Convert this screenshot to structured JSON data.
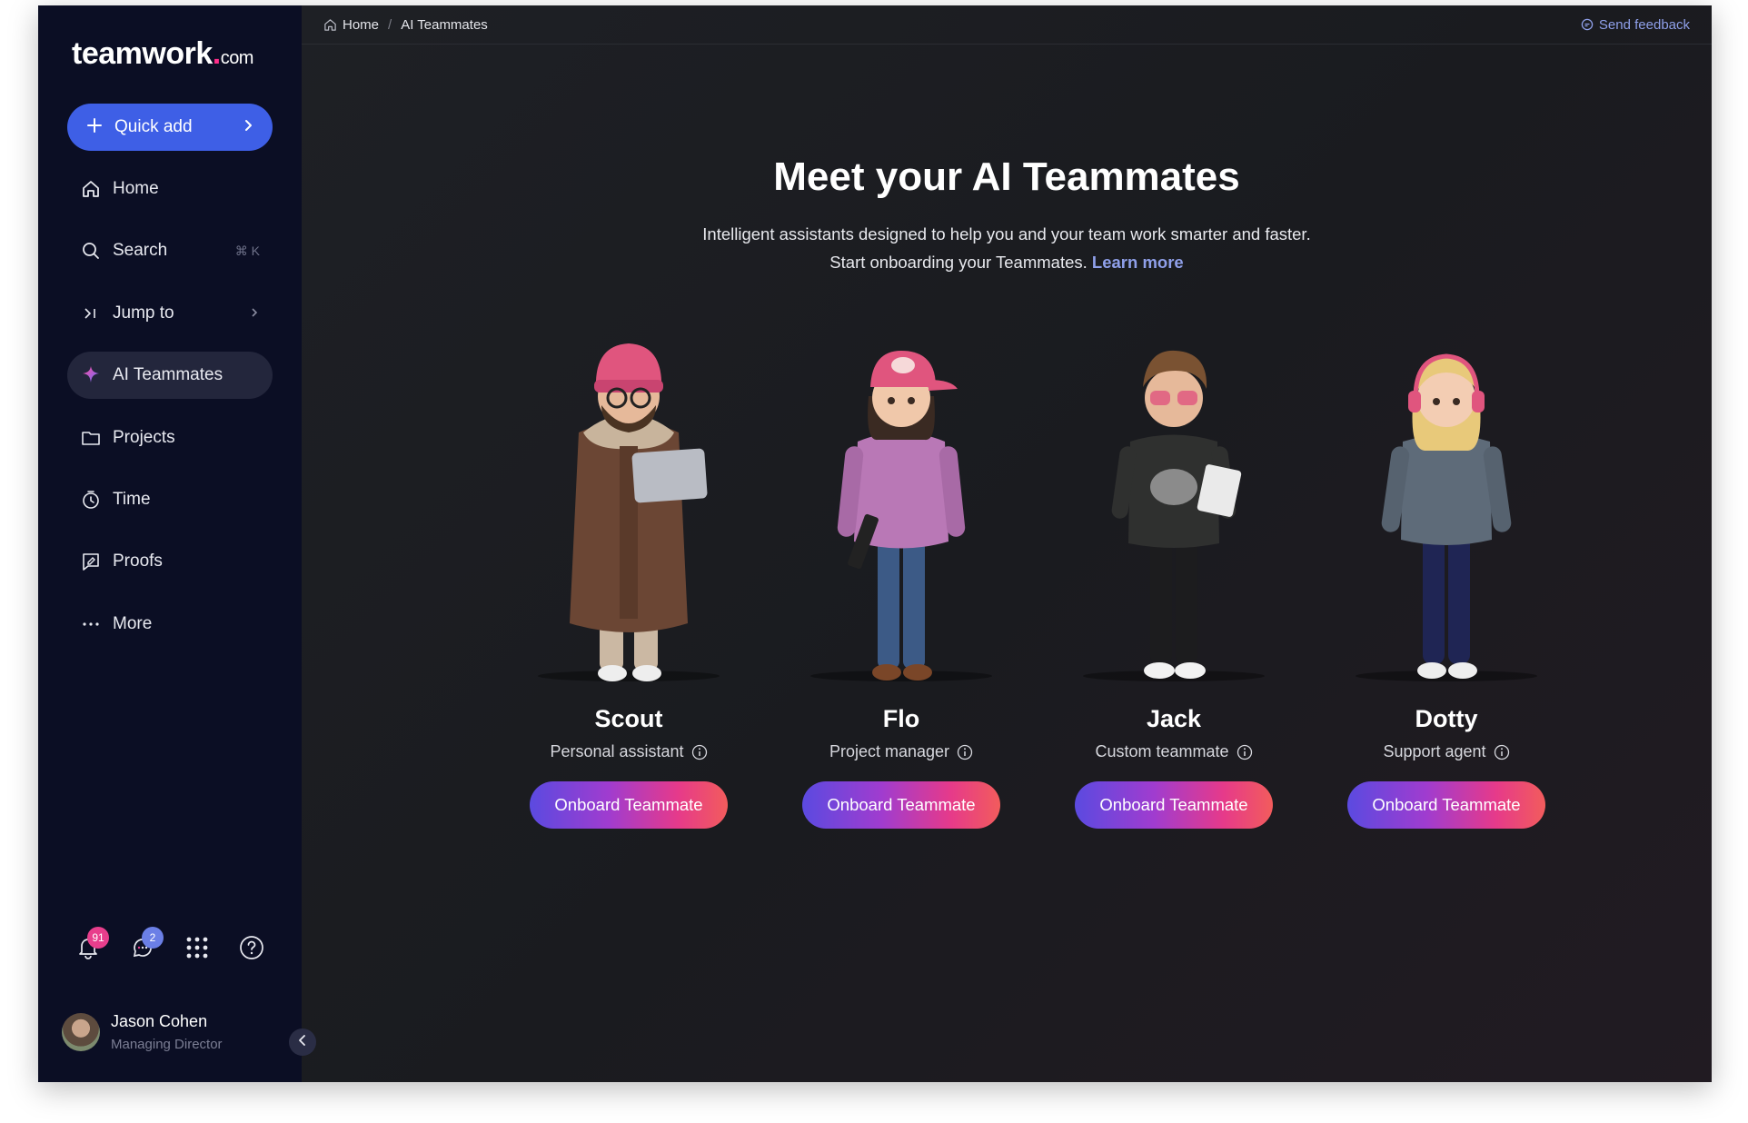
{
  "brand": {
    "name": "teamwork",
    "dot": ".",
    "tld": "com"
  },
  "sidebar": {
    "quick_add": "Quick add",
    "items": [
      {
        "label": "Home",
        "icon": "home-icon"
      },
      {
        "label": "Search",
        "icon": "search-icon",
        "shortcut": "⌘ K"
      },
      {
        "label": "Jump to",
        "icon": "jump-icon"
      },
      {
        "label": "AI Teammates",
        "icon": "sparkle-icon",
        "active": true
      },
      {
        "label": "Projects",
        "icon": "folder-icon"
      },
      {
        "label": "Time",
        "icon": "timer-icon"
      },
      {
        "label": "Proofs",
        "icon": "proofs-icon"
      },
      {
        "label": "More",
        "icon": "more-icon"
      }
    ],
    "notifications_count": "91",
    "messages_count": "2",
    "user": {
      "name": "Jason Cohen",
      "role": "Managing Director"
    }
  },
  "breadcrumb": {
    "home": "Home",
    "separator": "/",
    "current": "AI Teammates"
  },
  "feedback_label": "Send feedback",
  "hero": {
    "title": "Meet your AI Teammates",
    "line1": "Intelligent assistants designed to help you and your team work smarter and faster.",
    "line2": "Start onboarding your Teammates.",
    "link": "Learn more"
  },
  "teammates": [
    {
      "name": "Scout",
      "role": "Personal assistant",
      "button": "Onboard Teammate"
    },
    {
      "name": "Flo",
      "role": "Project manager",
      "button": "Onboard Teammate"
    },
    {
      "name": "Jack",
      "role": "Custom teammate",
      "button": "Onboard Teammate"
    },
    {
      "name": "Dotty",
      "role": "Support agent",
      "button": "Onboard Teammate"
    }
  ],
  "colors": {
    "accent": "#3e5fe6",
    "brand_pink": "#ff2e8a",
    "link": "#8fa0ea"
  }
}
